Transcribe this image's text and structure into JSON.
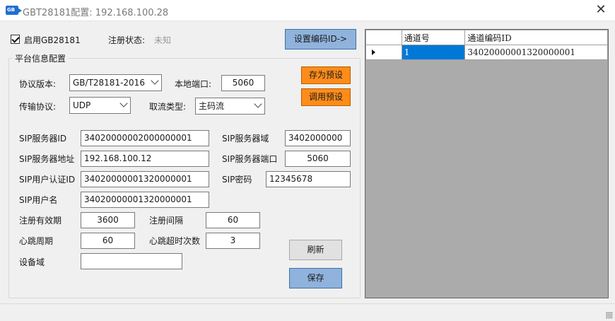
{
  "window": {
    "title": "GBT28181配置: 192.168.100.28",
    "icon_text": "GB",
    "close_glyph": "✕"
  },
  "header": {
    "enable_label": "启用GB28181",
    "enable_checked": true,
    "reg_status_label": "注册状态:",
    "reg_status_value": "未知",
    "set_channel_btn": "设置编码ID->"
  },
  "group": {
    "title": "平台信息配置"
  },
  "form": {
    "protocol_version_label": "协议版本:",
    "protocol_version_value": "GB/T28181-2016",
    "local_port_label": "本地端口:",
    "local_port_value": "5060",
    "transport_label": "传输协议:",
    "transport_value": "UDP",
    "stream_type_label": "取流类型:",
    "stream_type_value": "主码流",
    "sip_server_id_label": "SIP服务器ID",
    "sip_server_id_value": "34020000002000000001",
    "sip_server_domain_label": "SIP服务器域",
    "sip_server_domain_value": "3402000000",
    "sip_server_addr_label": "SIP服务器地址",
    "sip_server_addr_value": "192.168.100.12",
    "sip_server_port_label": "SIP服务器端口",
    "sip_server_port_value": "5060",
    "sip_auth_id_label": "SIP用户认证ID",
    "sip_auth_id_value": "34020000001320000001",
    "sip_password_label": "SIP密码",
    "sip_password_value": "12345678",
    "sip_username_label": "SIP用户名",
    "sip_username_value": "34020000001320000001",
    "reg_validity_label": "注册有效期",
    "reg_validity_value": "3600",
    "reg_interval_label": "注册间隔",
    "reg_interval_value": "60",
    "heartbeat_label": "心跳周期",
    "heartbeat_value": "60",
    "heartbeat_timeout_label": "心跳超时次数",
    "heartbeat_timeout_value": "3",
    "device_domain_label": "设备域",
    "device_domain_value": ""
  },
  "buttons": {
    "save_preset": "存为预设",
    "load_preset": "调用预设",
    "refresh": "刷新",
    "save": "保存"
  },
  "grid": {
    "columns": [
      "通道号",
      "通道编码ID"
    ],
    "rows": [
      {
        "channel_no": "1",
        "channel_id": "34020000001320000001"
      }
    ]
  },
  "colors": {
    "accent_blue": "#8fb3dc",
    "accent_orange": "#ff8c1a",
    "selection": "#0078d7",
    "grid_bg": "#ababab"
  }
}
